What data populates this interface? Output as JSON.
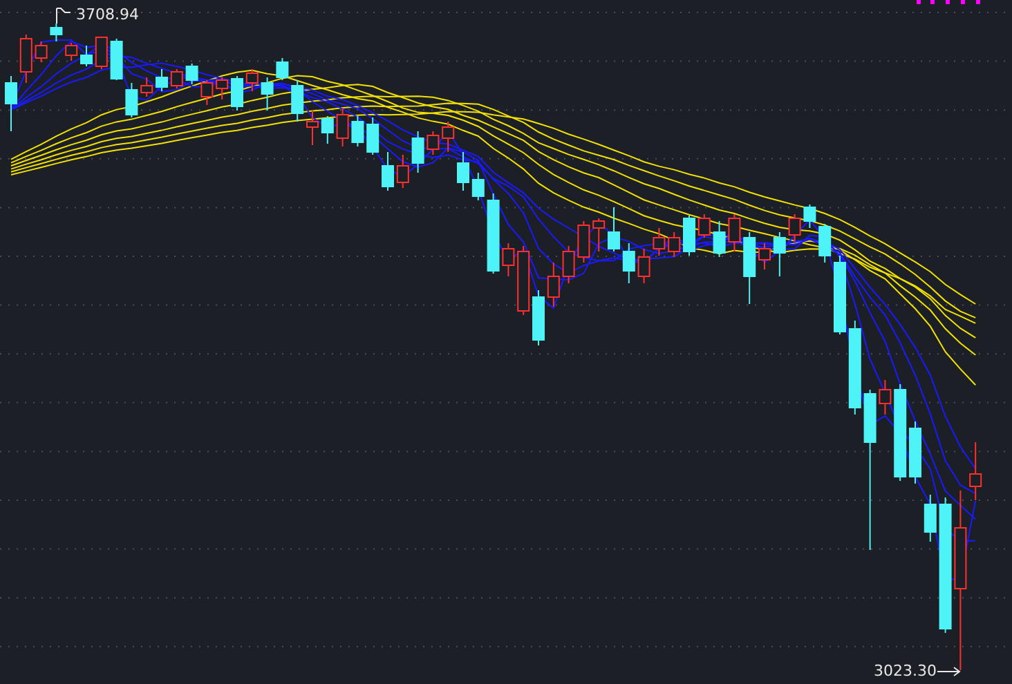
{
  "chart": {
    "high_label": "3708.94",
    "low_label": "3023.30"
  }
}
